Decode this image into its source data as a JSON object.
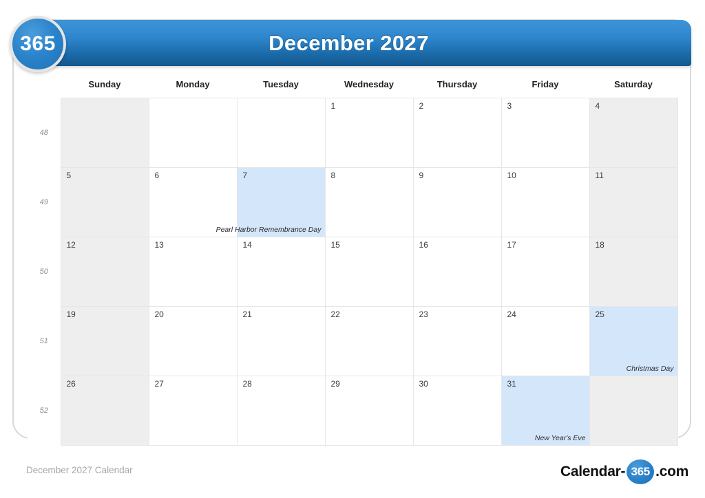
{
  "badge": {
    "label": "365"
  },
  "header": {
    "title": "December 2027"
  },
  "watermark": {
    "text": "365"
  },
  "weekdays": [
    {
      "label": "Sunday"
    },
    {
      "label": "Monday"
    },
    {
      "label": "Tuesday"
    },
    {
      "label": "Wednesday"
    },
    {
      "label": "Thursday"
    },
    {
      "label": "Friday"
    },
    {
      "label": "Saturday"
    }
  ],
  "weeks": [
    {
      "number": "48",
      "days": [
        {
          "number": "",
          "event": "",
          "weekend": true,
          "holiday": false,
          "blank": true
        },
        {
          "number": "",
          "event": "",
          "weekend": false,
          "holiday": false,
          "blank": true
        },
        {
          "number": "",
          "event": "",
          "weekend": false,
          "holiday": false,
          "blank": true
        },
        {
          "number": "1",
          "event": "",
          "weekend": false,
          "holiday": false,
          "blank": false
        },
        {
          "number": "2",
          "event": "",
          "weekend": false,
          "holiday": false,
          "blank": false
        },
        {
          "number": "3",
          "event": "",
          "weekend": false,
          "holiday": false,
          "blank": false
        },
        {
          "number": "4",
          "event": "",
          "weekend": true,
          "holiday": false,
          "blank": false
        }
      ]
    },
    {
      "number": "49",
      "days": [
        {
          "number": "5",
          "event": "",
          "weekend": true,
          "holiday": false,
          "blank": false
        },
        {
          "number": "6",
          "event": "",
          "weekend": false,
          "holiday": false,
          "blank": false
        },
        {
          "number": "7",
          "event": "Pearl Harbor Remembrance Day",
          "weekend": false,
          "holiday": true,
          "blank": false
        },
        {
          "number": "8",
          "event": "",
          "weekend": false,
          "holiday": false,
          "blank": false
        },
        {
          "number": "9",
          "event": "",
          "weekend": false,
          "holiday": false,
          "blank": false
        },
        {
          "number": "10",
          "event": "",
          "weekend": false,
          "holiday": false,
          "blank": false
        },
        {
          "number": "11",
          "event": "",
          "weekend": true,
          "holiday": false,
          "blank": false
        }
      ]
    },
    {
      "number": "50",
      "days": [
        {
          "number": "12",
          "event": "",
          "weekend": true,
          "holiday": false,
          "blank": false
        },
        {
          "number": "13",
          "event": "",
          "weekend": false,
          "holiday": false,
          "blank": false
        },
        {
          "number": "14",
          "event": "",
          "weekend": false,
          "holiday": false,
          "blank": false
        },
        {
          "number": "15",
          "event": "",
          "weekend": false,
          "holiday": false,
          "blank": false
        },
        {
          "number": "16",
          "event": "",
          "weekend": false,
          "holiday": false,
          "blank": false
        },
        {
          "number": "17",
          "event": "",
          "weekend": false,
          "holiday": false,
          "blank": false
        },
        {
          "number": "18",
          "event": "",
          "weekend": true,
          "holiday": false,
          "blank": false
        }
      ]
    },
    {
      "number": "51",
      "days": [
        {
          "number": "19",
          "event": "",
          "weekend": true,
          "holiday": false,
          "blank": false
        },
        {
          "number": "20",
          "event": "",
          "weekend": false,
          "holiday": false,
          "blank": false
        },
        {
          "number": "21",
          "event": "",
          "weekend": false,
          "holiday": false,
          "blank": false
        },
        {
          "number": "22",
          "event": "",
          "weekend": false,
          "holiday": false,
          "blank": false
        },
        {
          "number": "23",
          "event": "",
          "weekend": false,
          "holiday": false,
          "blank": false
        },
        {
          "number": "24",
          "event": "",
          "weekend": false,
          "holiday": false,
          "blank": false
        },
        {
          "number": "25",
          "event": "Christmas Day",
          "weekend": true,
          "holiday": true,
          "blank": false
        }
      ]
    },
    {
      "number": "52",
      "days": [
        {
          "number": "26",
          "event": "",
          "weekend": true,
          "holiday": false,
          "blank": false
        },
        {
          "number": "27",
          "event": "",
          "weekend": false,
          "holiday": false,
          "blank": false
        },
        {
          "number": "28",
          "event": "",
          "weekend": false,
          "holiday": false,
          "blank": false
        },
        {
          "number": "29",
          "event": "",
          "weekend": false,
          "holiday": false,
          "blank": false
        },
        {
          "number": "30",
          "event": "",
          "weekend": false,
          "holiday": false,
          "blank": false
        },
        {
          "number": "31",
          "event": "New Year's Eve",
          "weekend": false,
          "holiday": true,
          "blank": false
        },
        {
          "number": "",
          "event": "",
          "weekend": true,
          "holiday": false,
          "blank": true
        }
      ]
    }
  ],
  "footer": {
    "caption": "December 2027 Calendar",
    "logo_left": "Calendar-",
    "logo_circle": "365",
    "logo_right": ".com"
  },
  "colors": {
    "header_gradient_top": "#3f94d8",
    "header_gradient_bottom": "#14578d",
    "holiday_cell": "#d4e6f9",
    "weekend_cell": "#eeeeee",
    "grid_line": "#e6e6e6",
    "frame_border": "#d9d9d9",
    "footer_caption": "#a6a6a6"
  }
}
